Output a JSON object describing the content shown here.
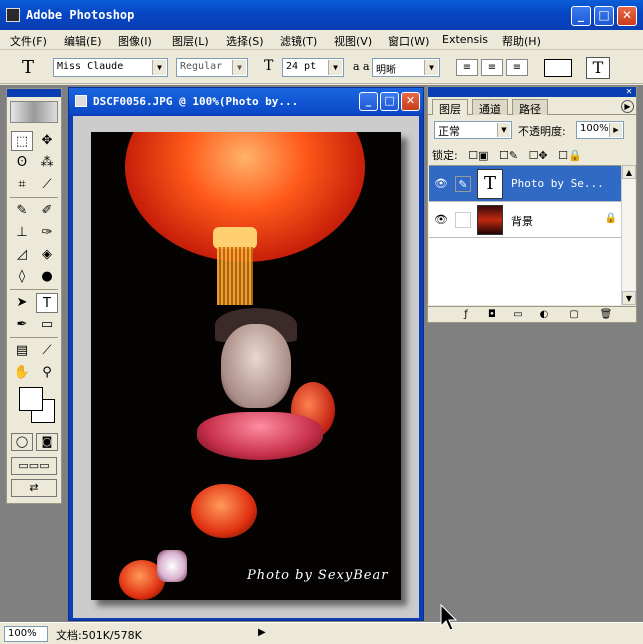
{
  "app": {
    "title": "Adobe Photoshop"
  },
  "menubar": {
    "items": [
      "文件(F)",
      "编辑(E)",
      "图像(I)",
      "图层(L)",
      "选择(S)",
      "滤镜(T)",
      "视图(V)",
      "窗口(W)",
      "Extensis",
      "帮助(H)"
    ]
  },
  "options": {
    "tool_glyph": "T",
    "font_family": "Miss Claude",
    "font_style": "Regular",
    "font_size": "24 pt",
    "aa_label": "a a",
    "aa_method": "明晰",
    "text_color": "#ffffff"
  },
  "document": {
    "title": "DSCF0056.JPG @ 100%(Photo by...",
    "caption": "Photo by SexyBear"
  },
  "layers_panel": {
    "tabs": [
      "图层",
      "通道",
      "路径"
    ],
    "blend_mode": "正常",
    "opacity_label": "不透明度:",
    "opacity": "100%",
    "lock_label": "锁定:",
    "layers": [
      {
        "name": "Photo by Se...",
        "thumb": "T",
        "selected": true
      },
      {
        "name": "背景",
        "thumb": "",
        "selected": false,
        "locked": true
      }
    ]
  },
  "status": {
    "zoom": "100%",
    "doc_info": "文档:501K/578K"
  },
  "colors": {
    "titlebar": "#0a48c8",
    "selection": "#316ac5",
    "workspace": "#808080"
  }
}
